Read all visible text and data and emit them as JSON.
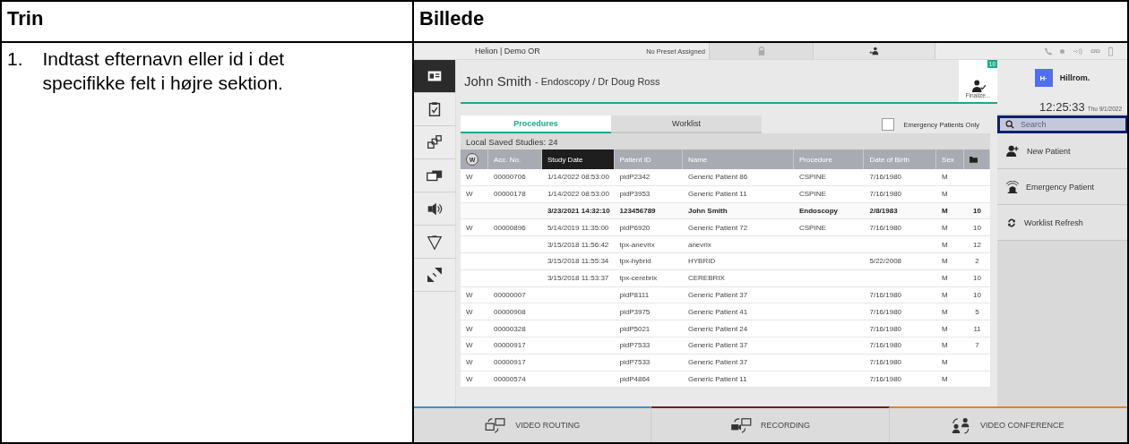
{
  "doc_table": {
    "columns": [
      "Trin",
      "Billede"
    ],
    "step": {
      "number": "1.",
      "text": "Indtast efternavn eller id i det specifikke felt i højre sektion."
    }
  },
  "app": {
    "top_bar": {
      "location": "Helion | Demo OR",
      "preset": "No Preset Assigned"
    },
    "nav_items": [
      {
        "selected": true
      },
      {
        "selected": false
      },
      {
        "selected": false
      },
      {
        "selected": false
      },
      {
        "selected": false
      },
      {
        "selected": false
      },
      {
        "selected": false
      }
    ],
    "patient": {
      "name": "John Smith",
      "details": "- Endoscopy / Dr Doug Ross"
    },
    "finalize": {
      "label": "Finalize...",
      "badge": "10"
    },
    "brand": {
      "logo": "H·",
      "name": "Hillrom."
    },
    "clock": {
      "time": "12:25:33",
      "date": "Thu 9/1/2022"
    },
    "search": {
      "placeholder": "Search",
      "highlighted": true
    },
    "actions": [
      {
        "label": "New Patient",
        "kind": "new-patient"
      },
      {
        "label": "Emergency Patient",
        "kind": "emergency"
      },
      {
        "label": "Worklist Refresh",
        "kind": "refresh"
      }
    ],
    "tabs": [
      {
        "label": "Procedures",
        "selected": true
      },
      {
        "label": "Worklist",
        "selected": false
      }
    ],
    "emergency_only": {
      "label": "Emergency Patients Only",
      "checked": false
    },
    "saved_studies": "Local Saved Studies: 24",
    "table": {
      "columns": [
        {
          "label": "W",
          "kind": "circle",
          "selected": false
        },
        {
          "label": "Acc. No.",
          "kind": "text",
          "selected": false
        },
        {
          "label": "Study Date",
          "kind": "text",
          "selected": true
        },
        {
          "label": "Patient ID",
          "kind": "text",
          "selected": false
        },
        {
          "label": "Name",
          "kind": "text",
          "selected": false
        },
        {
          "label": "Procedure",
          "kind": "text",
          "selected": false
        },
        {
          "label": "Date of Birth",
          "kind": "text",
          "selected": false
        },
        {
          "label": "Sex",
          "kind": "text",
          "selected": false
        },
        {
          "kind": "folder",
          "selected": false
        }
      ],
      "rows": [
        {
          "current": false,
          "cells": [
            "W",
            "00000706",
            "1/14/2022 08:53:00",
            "pidP2342",
            "Generic Patient 86",
            "CSPINE",
            "7/16/1980",
            "M",
            null
          ]
        },
        {
          "current": false,
          "cells": [
            "W",
            "00000178",
            "1/14/2022 08:53:00",
            "pidP3953",
            "Generic Patient 11",
            "CSPINE",
            "7/16/1980",
            "M",
            null
          ]
        },
        {
          "current": true,
          "cells": [
            null,
            null,
            "3/23/2021 14:32:10",
            "123456789",
            "John Smith",
            "Endoscopy",
            "2/8/1983",
            "M",
            "10"
          ]
        },
        {
          "current": false,
          "cells": [
            "W",
            "00000896",
            "5/14/2019 11:35:00",
            "pidP6920",
            "Generic Patient 72",
            "CSPINE",
            "7/16/1980",
            "M",
            "10"
          ]
        },
        {
          "current": false,
          "cells": [
            null,
            null,
            "3/15/2018 11:56:42",
            "tpx-anevrix",
            "anevrix",
            null,
            null,
            "M",
            "12"
          ]
        },
        {
          "current": false,
          "cells": [
            null,
            null,
            "3/15/2018 11:55:34",
            "tpx-hybrid",
            "HYBRID",
            null,
            "5/22/2008",
            "M",
            "2"
          ]
        },
        {
          "current": false,
          "cells": [
            null,
            null,
            "3/15/2018 11:53:37",
            "tpx-cerebrix",
            "CEREBRIX",
            null,
            null,
            "M",
            "10"
          ]
        },
        {
          "current": false,
          "cells": [
            "W",
            "00000007",
            null,
            "pidP8111",
            "Generic Patient 37",
            null,
            "7/16/1980",
            "M",
            "10"
          ]
        },
        {
          "current": false,
          "cells": [
            "W",
            "00000908",
            null,
            "pidP3975",
            "Generic Patient 41",
            null,
            "7/16/1980",
            "M",
            "5"
          ]
        },
        {
          "current": false,
          "cells": [
            "W",
            "00000328",
            null,
            "pidP5021",
            "Generic Patient 24",
            null,
            "7/16/1980",
            "M",
            "11"
          ]
        },
        {
          "current": false,
          "cells": [
            "W",
            "00000917",
            null,
            "pidP7533",
            "Generic Patient 37",
            null,
            "7/16/1980",
            "M",
            "7"
          ]
        },
        {
          "current": false,
          "cells": [
            "W",
            "00000917",
            null,
            "pidP7533",
            "Generic Patient 37",
            null,
            "7/16/1980",
            "M",
            null
          ]
        },
        {
          "current": false,
          "cells": [
            "W",
            "00000574",
            null,
            "pidP4864",
            "Generic Patient 11",
            null,
            "7/16/1980",
            "M",
            null
          ]
        }
      ]
    },
    "bottom_tabs": [
      {
        "label": "VIDEO ROUTING",
        "kind": "routing",
        "color": "#3b8fd8"
      },
      {
        "label": "RECORDING",
        "kind": "recording",
        "color": "#7a1a1a"
      },
      {
        "label": "VIDEO CONFERENCE",
        "kind": "conference",
        "color": "#e8821e"
      }
    ]
  }
}
